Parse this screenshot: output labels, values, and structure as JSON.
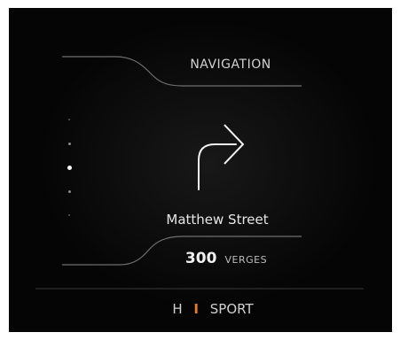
{
  "header": {
    "title": "NAVIGATION"
  },
  "turn": {
    "icon": "turn-right-arrow-icon",
    "street": "Matthew Street"
  },
  "distance": {
    "value": "300",
    "unit": "VERGES"
  },
  "mode": {
    "left": "H",
    "separator": "I",
    "right": "SPORT"
  },
  "pager": {
    "count": 5,
    "active_index": 2
  },
  "colors": {
    "background": "#050505",
    "accent": "#e87a28",
    "text": "#e6e6e6"
  }
}
